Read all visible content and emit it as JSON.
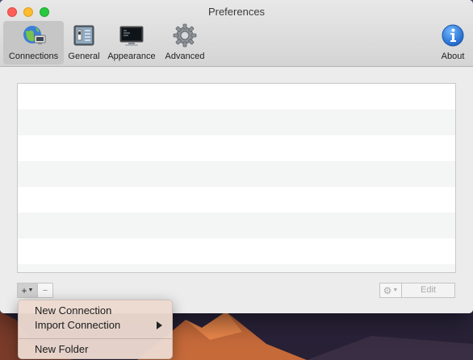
{
  "window": {
    "title": "Preferences"
  },
  "toolbar": {
    "items": [
      {
        "label": "Connections",
        "icon": "globe-network-icon",
        "selected": true
      },
      {
        "label": "General",
        "icon": "switch-panel-icon",
        "selected": false
      },
      {
        "label": "Appearance",
        "icon": "monitor-icon",
        "selected": false
      },
      {
        "label": "Advanced",
        "icon": "gear-icon",
        "selected": false
      }
    ],
    "about": {
      "label": "About",
      "icon": "info-icon"
    }
  },
  "connections": {
    "rows": [],
    "add_button": "+",
    "remove_button": "−",
    "edit_button": "Edit"
  },
  "add_menu": {
    "items": [
      {
        "label": "New Connection",
        "has_submenu": false
      },
      {
        "label": "Import Connection",
        "has_submenu": true
      },
      {
        "label": "New Folder",
        "has_submenu": false
      }
    ]
  },
  "colors": {
    "selected_toolbar_bg": "#c6c6c6",
    "info_blue": "#1f7ee0",
    "menu_bg": "#ecdad0"
  }
}
